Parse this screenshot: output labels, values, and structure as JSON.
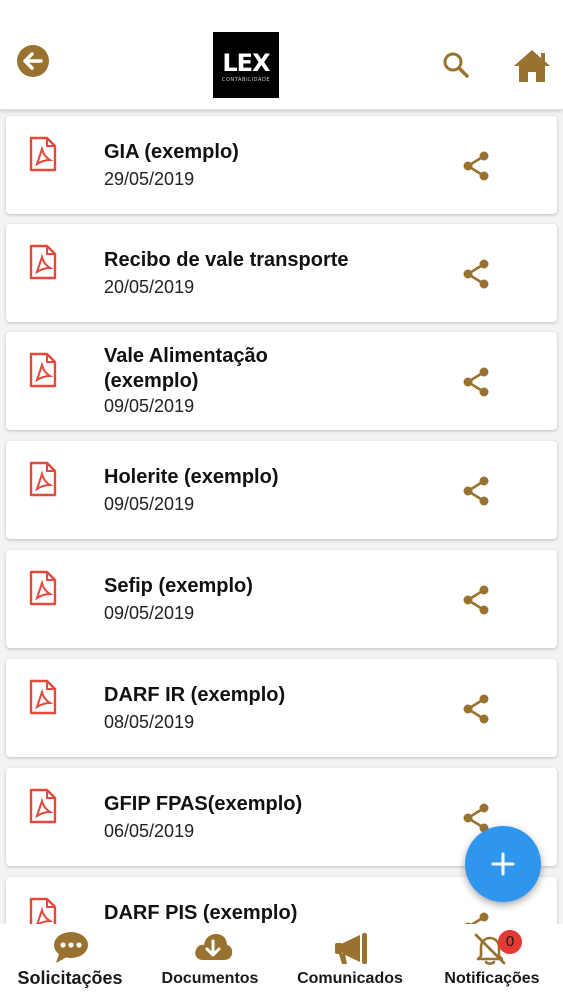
{
  "header": {
    "logo_text": "LEX",
    "logo_subtext": "CONTABILIDADE"
  },
  "documents": [
    {
      "title": "GIA (exemplo)",
      "date": "29/05/2019"
    },
    {
      "title": "Recibo de vale transporte",
      "date": "20/05/2019"
    },
    {
      "title": "Vale Alimentação (exemplo)",
      "date": "09/05/2019"
    },
    {
      "title": "Holerite (exemplo)",
      "date": "09/05/2019"
    },
    {
      "title": "Sefip (exemplo)",
      "date": "09/05/2019"
    },
    {
      "title": "DARF IR (exemplo)",
      "date": "08/05/2019"
    },
    {
      "title": "GFIP FPAS(exemplo)",
      "date": "06/05/2019"
    },
    {
      "title": "DARF PIS (exemplo)",
      "date": ""
    }
  ],
  "nav": {
    "solicitacoes": "Solicitações",
    "documentos": "Documentos",
    "comunicados": "Comunicados",
    "notificacoes": "Notificações",
    "notification_count": "0"
  },
  "colors": {
    "accent": "#9a7230",
    "pdf_red": "#e24b3b",
    "fab_blue": "#2f96ee",
    "badge_red": "#e53935"
  },
  "icons": {
    "back": "arrow-left-circle-icon",
    "search": "search-icon",
    "home": "home-icon",
    "document": "pdf-file-icon",
    "share": "share-icon",
    "fab": "plus-icon",
    "nav_solicitacoes": "chat-bubble-icon",
    "nav_documentos": "cloud-download-icon",
    "nav_comunicados": "megaphone-icon",
    "nav_notificacoes": "bell-off-icon"
  }
}
